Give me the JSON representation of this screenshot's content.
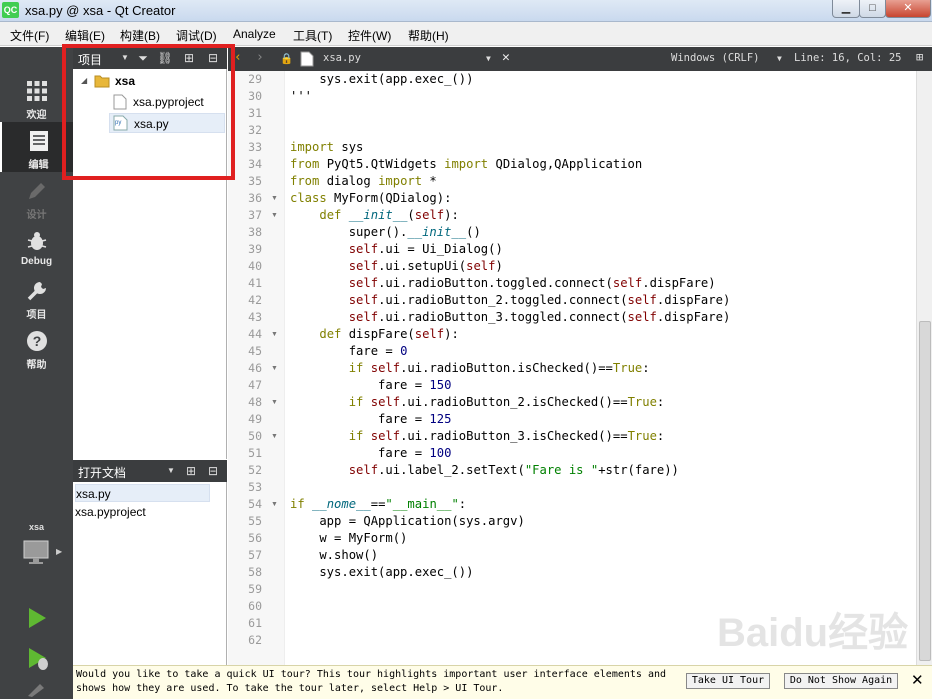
{
  "window": {
    "title": "xsa.py @ xsa - Qt Creator",
    "app_icon": "QC"
  },
  "menubar": [
    "文件(F)",
    "编辑(E)",
    "构建(B)",
    "调试(D)",
    "Analyze",
    "工具(T)",
    "控件(W)",
    "帮助(H)"
  ],
  "modes": [
    {
      "label": "欢迎",
      "icon": "grid-icon"
    },
    {
      "label": "编辑",
      "icon": "document-icon"
    },
    {
      "label": "设计",
      "icon": "pencil-icon"
    },
    {
      "label": "Debug",
      "icon": "bug-icon"
    },
    {
      "label": "项目",
      "icon": "wrench-icon"
    },
    {
      "label": "帮助",
      "icon": "help-icon"
    }
  ],
  "kit": {
    "label": "xsa",
    "icon": "monitor-icon"
  },
  "project_panel": {
    "title": "项目",
    "root": "xsa",
    "files": [
      "xsa.pyproject",
      "xsa.py"
    ],
    "file_badge": "py"
  },
  "open_docs": {
    "title": "打开文档",
    "files": [
      "xsa.py",
      "xsa.pyproject"
    ]
  },
  "editor_toolbar": {
    "filename": "xsa.py",
    "line_ending": "Windows (CRLF)",
    "position": "Line: 16, Col: 25"
  },
  "code": {
    "line_numbers": [
      "29",
      "30",
      "31",
      "32",
      "33",
      "34",
      "35",
      "36",
      "37",
      "38",
      "39",
      "40",
      "41",
      "42",
      "43",
      "44",
      "45",
      "46",
      "47",
      "48",
      "49",
      "50",
      "51",
      "52",
      "53",
      "54",
      "55",
      "56",
      "57",
      "58",
      "59",
      "60",
      "61",
      "62"
    ],
    "lines": [
      "    sys.exit(app.exec_())",
      "'''",
      "",
      "",
      "import sys",
      "from PyQt5.QtWidgets import QDialog,QApplication",
      "from dialog import *",
      "class MyForm(QDialog):",
      "    def __init__(self):",
      "        super().__init__()",
      "        self.ui = Ui_Dialog()",
      "        self.ui.setupUi(self)",
      "        self.ui.radioButton.toggled.connect(self.dispFare)",
      "        self.ui.radioButton_2.toggled.connect(self.dispFare)",
      "        self.ui.radioButton_3.toggled.connect(self.dispFare)",
      "    def dispFare(self):",
      "        fare = 0",
      "        if self.ui.radioButton.isChecked()==True:",
      "            fare = 150",
      "        if self.ui.radioButton_2.isChecked()==True:",
      "            fare = 125",
      "        if self.ui.radioButton_3.isChecked()==True:",
      "            fare = 100",
      "        self.ui.label_2.setText(\"Fare is \"+str(fare))",
      "",
      "if __nome__==\"__main__\":",
      "    app = QApplication(sys.argv)",
      "    w = MyForm()",
      "    w.show()",
      "    sys.exit(app.exec_())",
      "",
      "",
      "",
      ""
    ]
  },
  "tour": {
    "line1": "Would you like to take a quick UI tour? This tour highlights important user interface elements and",
    "line2": "shows how they are used. To take the tour later, select Help > UI Tour.",
    "take_button": "Take UI Tour",
    "dismiss_button": "Do Not Show Again"
  },
  "watermark": "Baidu经验",
  "colors": {
    "highlight_box": "#e02020",
    "sidebar": "#404244"
  }
}
